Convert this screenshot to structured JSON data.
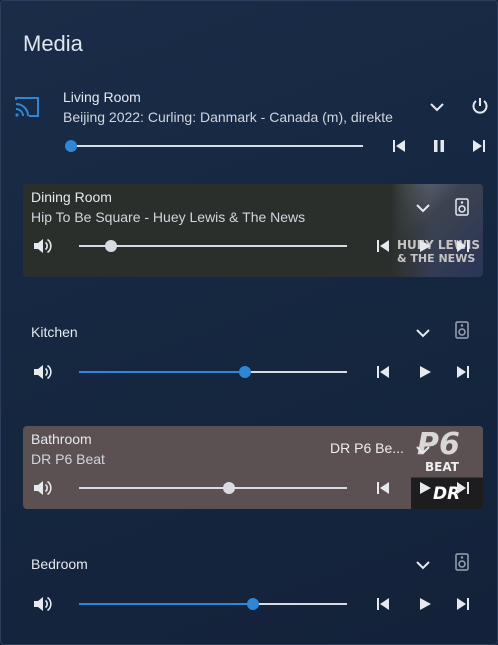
{
  "card": {
    "title": "Media"
  },
  "living_room": {
    "name": "Living Room",
    "media_title": "Beijing 2022: Curling: Danmark - Canada (m), direkte",
    "progress": 0.0
  },
  "dining_room": {
    "name": "Dining Room",
    "media_title": "Hip To Be Square - Huey Lewis & The News",
    "volume": 0.12,
    "art_text_line1": "HUEY LEWIS",
    "art_text_line2": "& THE NEWS"
  },
  "kitchen": {
    "name": "Kitchen",
    "volume": 0.62
  },
  "bathroom": {
    "name": "Bathroom",
    "media_title": "DR P6 Beat",
    "source": "DR P6 Be...",
    "volume": 0.56,
    "art_text_line1": "P6",
    "art_text_line2": "BEAT",
    "art_text_line3": "DR"
  },
  "bedroom": {
    "name": "Bedroom",
    "volume": 0.65
  },
  "colors": {
    "accent": "#2f86d6",
    "dining_bg": "#2b2f2c",
    "bathroom_bg": "#5b5153"
  }
}
